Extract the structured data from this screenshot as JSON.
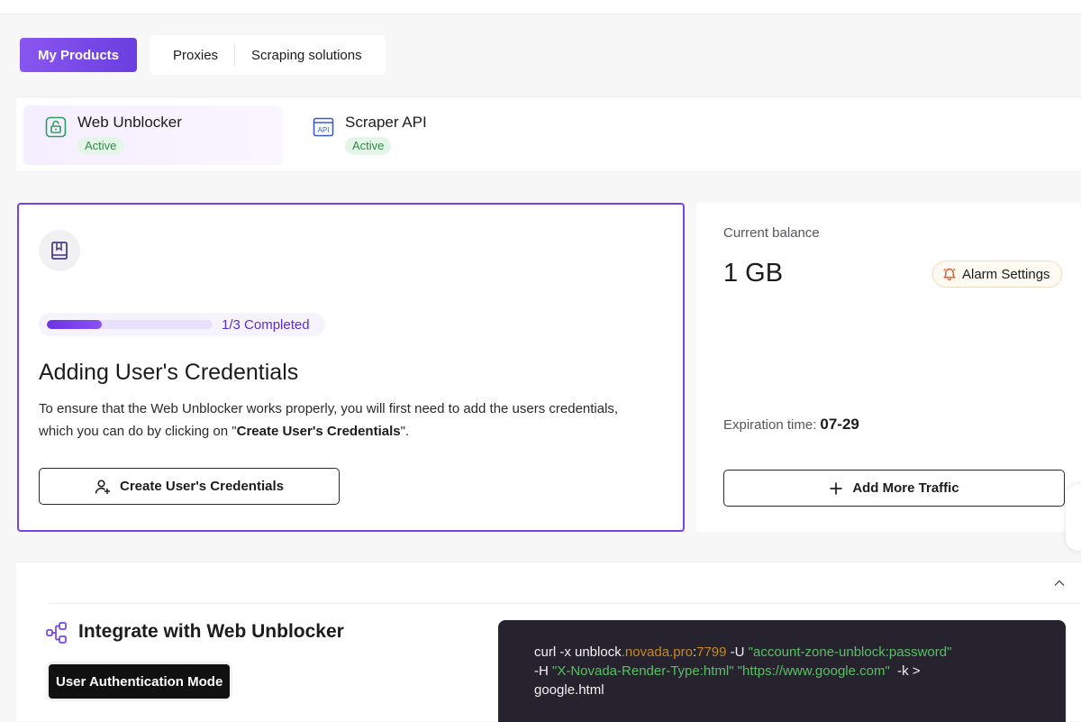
{
  "nav": {
    "tabs": [
      {
        "label": "My Products"
      },
      {
        "label": "Proxies"
      },
      {
        "label": "Scraping solutions"
      }
    ]
  },
  "products": [
    {
      "name": "Web Unblocker",
      "status": "Active",
      "icon": "lock-icon"
    },
    {
      "name": "Scraper API",
      "status": "Active",
      "icon": "api-icon",
      "icon_text": "API"
    }
  ],
  "guide": {
    "icon": "book-icon",
    "progress_fraction": 0.33,
    "progress_text": "1/3 Completed",
    "title": "Adding User's Credentials",
    "desc_before": "To ensure that the Web Unblocker works properly, you will first need to add the users credentials, which you can do by clicking on \"",
    "desc_bold": "Create User's Credentials",
    "desc_after": "\".",
    "button_label": "Create User's Credentials"
  },
  "balance": {
    "label": "Current balance",
    "value": "1 GB",
    "alarm_label": "Alarm Settings",
    "expiration_label": "Expiration time:",
    "expiration_value": "07-29",
    "add_traffic_label": "Add More Traffic"
  },
  "integrate": {
    "title": "Integrate with Web Unblocker",
    "mode_label": "User Authentication Mode",
    "code": {
      "cmd": "curl  -x unblock",
      "host": ".novada.pro",
      "colon": ":",
      "port": "7799",
      "user_flag": " -U ",
      "user": "\"account-zone-unblock:password\"",
      "header_flag": "-H ",
      "header": "\"X-Novada-Render-Type:html\"",
      "space": " ",
      "url": "\"https://www.google.com\"",
      "tail": "  -k >",
      "output": "google.html"
    }
  },
  "colors": {
    "accent": "#7444e6",
    "badge_bg": "#e4f6e8",
    "badge_text": "#2f8a47",
    "code_bg": "#27232e",
    "code_string": "#57c063",
    "code_host": "#c7891d"
  }
}
